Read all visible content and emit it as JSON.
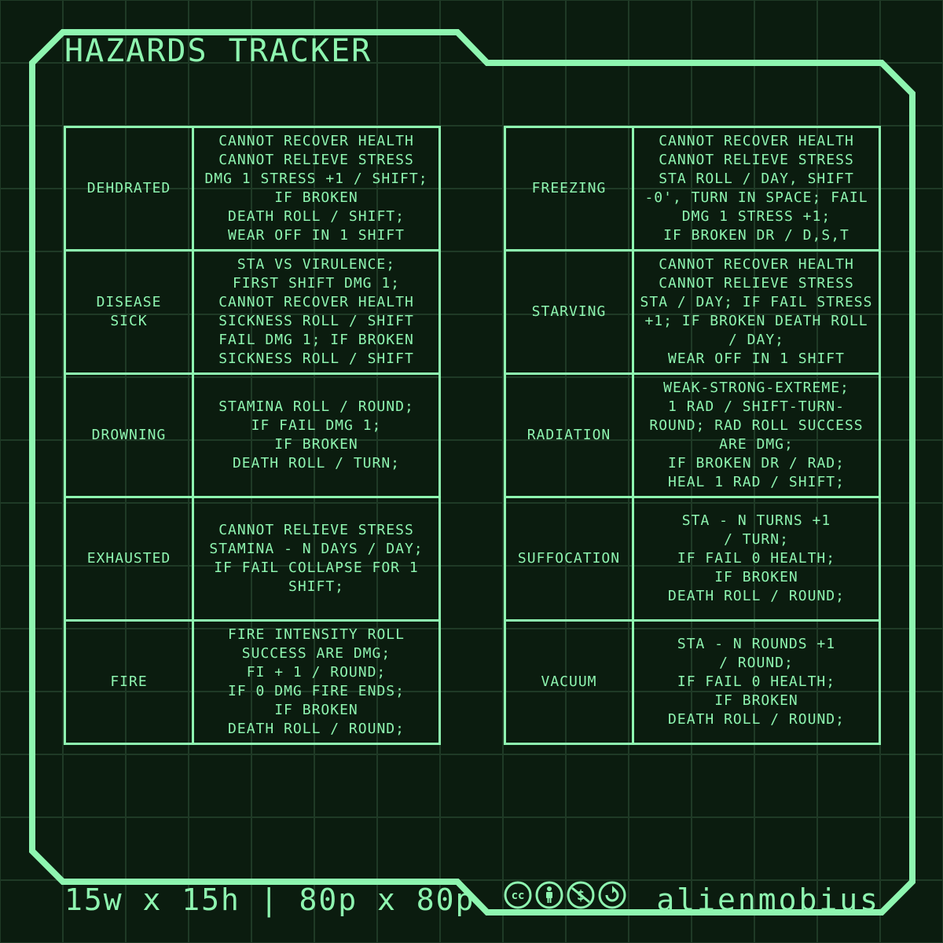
{
  "title": "HAZARDS TRACKER",
  "colors": {
    "background": "#0b1c0f",
    "grid": "#1f3a26",
    "accent": "#8ef5b0"
  },
  "left_table": [
    {
      "hazard": "DEHDRATED",
      "effect": "CANNOT RECOVER HEALTH\nCANNOT RELIEVE STRESS\nDMG 1 STRESS +1 / SHIFT;\nIF BROKEN\nDEATH ROLL / SHIFT;\nWEAR OFF IN 1 SHIFT"
    },
    {
      "hazard": "DISEASE\nSICK",
      "effect": "STA VS VIRULENCE;\nFIRST SHIFT DMG 1;\nCANNOT RECOVER HEALTH\nSICKNESS ROLL / SHIFT\nFAIL DMG 1; IF BROKEN\nSICKNESS ROLL / SHIFT"
    },
    {
      "hazard": "DROWNING",
      "effect": "STAMINA ROLL / ROUND;\nIF FAIL DMG 1;\nIF BROKEN\nDEATH ROLL / TURN;"
    },
    {
      "hazard": "EXHAUSTED",
      "effect": "CANNOT RELIEVE STRESS\nSTAMINA - N DAYS / DAY;\nIF FAIL COLLAPSE FOR 1\nSHIFT;"
    },
    {
      "hazard": "FIRE",
      "effect": "FIRE INTENSITY ROLL\nSUCCESS ARE DMG;\nFI + 1 / ROUND;\nIF 0 DMG FIRE ENDS;\nIF BROKEN\nDEATH ROLL / ROUND;"
    }
  ],
  "right_table": [
    {
      "hazard": "FREEZING",
      "effect": "CANNOT RECOVER HEALTH\nCANNOT RELIEVE STRESS\nSTA ROLL / DAY, SHIFT\n-0', TURN IN SPACE; FAIL\nDMG 1 STRESS +1;\nIF BROKEN DR / D,S,T"
    },
    {
      "hazard": "STARVING",
      "effect": "CANNOT RECOVER HEALTH\nCANNOT RELIEVE STRESS\nSTA / DAY; IF FAIL STRESS\n+1; IF BROKEN DEATH ROLL\n/ DAY;\nWEAR OFF IN 1 SHIFT"
    },
    {
      "hazard": "RADIATION",
      "effect": "WEAK-STRONG-EXTREME;\n1 RAD / SHIFT-TURN-\nROUND; RAD ROLL SUCCESS\nARE DMG;\nIF BROKEN DR / RAD;\nHEAL 1 RAD / SHIFT;"
    },
    {
      "hazard": "SUFFOCATION",
      "effect": "STA - N TURNS +1\n/ TURN;\nIF FAIL 0 HEALTH;\nIF BROKEN\nDEATH ROLL / ROUND;"
    },
    {
      "hazard": "VACUUM",
      "effect": "STA - N ROUNDS +1\n/ ROUND;\nIF FAIL 0 HEALTH;\nIF BROKEN\nDEATH ROLL / ROUND;"
    }
  ],
  "footer": {
    "size": "15w x 15h | 80p x 80p",
    "author": "alienmobius",
    "license_icons": [
      "cc-icon",
      "by-person-icon",
      "nc-dollar-icon",
      "sa-share-alike-icon"
    ]
  }
}
